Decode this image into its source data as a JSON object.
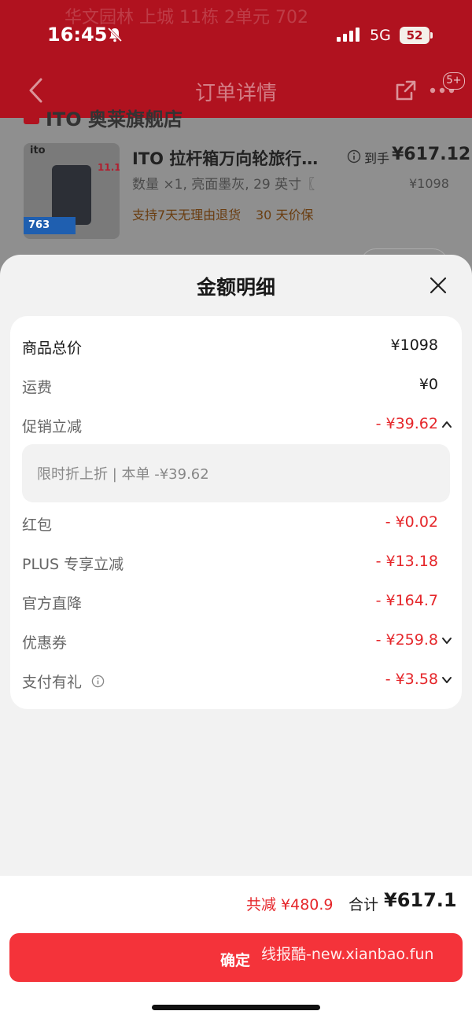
{
  "status_bar": {
    "time": "16:45",
    "network": "5G",
    "battery": "52"
  },
  "background": {
    "faded_address": "华文园林 上城 11栋 2单元 702",
    "nav_title": "订单详情",
    "more_badge": "5+",
    "store_name": "ITO 奥莱旗舰店",
    "product": {
      "thumb_brand": "ito",
      "thumb_promo": "11.11",
      "thumb_price": "763",
      "title": "ITO 拉杆箱万向轮旅行…",
      "spec": "数量 ×1, 亮面墨灰, 29 英寸〖",
      "tag_return": "支持7天无理由退货",
      "tag_price_protect": "30 天价保",
      "price_label": "到手",
      "price_main": "¥617.12",
      "price_original": "¥1098"
    }
  },
  "sheet": {
    "title": "金额明细",
    "rows": [
      {
        "label": "商品总价",
        "value": "¥1098"
      },
      {
        "label": "运费",
        "value": "¥0"
      },
      {
        "label": "促销立减",
        "value": "- ¥39.62"
      },
      {
        "label": "红包",
        "value": "- ¥0.02"
      },
      {
        "label": "PLUS 专享立减",
        "value": "- ¥13.18"
      },
      {
        "label": "官方直降",
        "value": "- ¥164.7"
      },
      {
        "label": "优惠券",
        "value": "- ¥259.8"
      },
      {
        "label": "支付有礼",
        "value": "- ¥3.58"
      }
    ],
    "promo_detail": "限时折上折 | 本单 -¥39.62",
    "summary": {
      "total_cut": "共减 ¥480.9",
      "total_label": "合计",
      "total_amount": "¥617.1"
    },
    "confirm_label": "确定",
    "watermark": "线报酷-new.xianbao.fun"
  },
  "colors": {
    "accent": "#f4333a",
    "discount": "#e5262a",
    "header": "#b0121f"
  }
}
